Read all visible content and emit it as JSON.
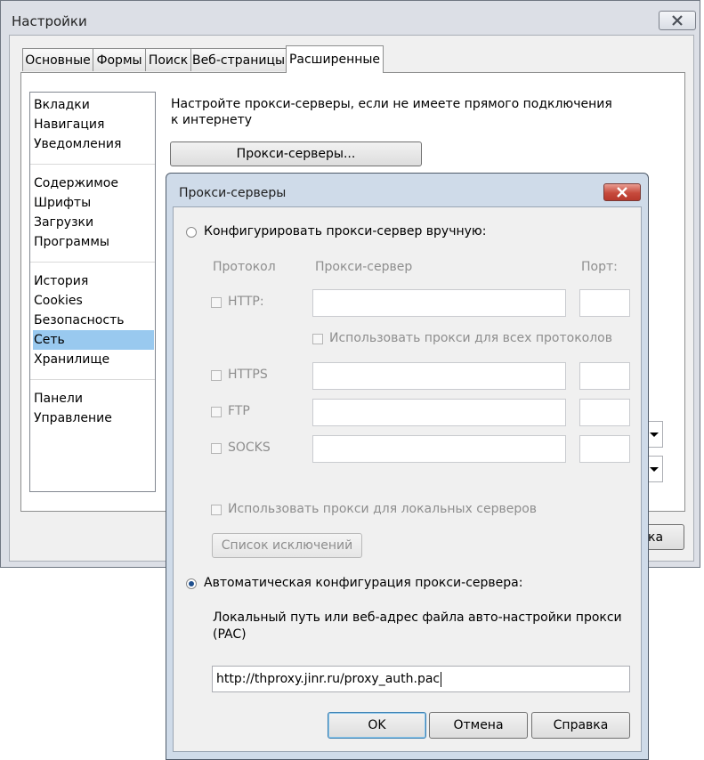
{
  "main_window": {
    "title": "Настройки",
    "tabs": [
      "Основные",
      "Формы",
      "Поиск",
      "Веб-страницы",
      "Расширенные"
    ],
    "active_tab_index": 4,
    "categories": [
      [
        "Вкладки",
        "Навигация",
        "Уведомления"
      ],
      [
        "Содержимое",
        "Шрифты",
        "Загрузки",
        "Программы"
      ],
      [
        "История",
        "Cookies",
        "Безопасность",
        "Сеть",
        "Хранилище"
      ],
      [
        "Панели",
        "Управление"
      ]
    ],
    "selected_category": "Сеть",
    "network_description": "Настройте прокси-серверы, если не имеете прямого подключения к интернету",
    "proxy_button_label": "Прокси-серверы...",
    "partial_button_label": "ка"
  },
  "proxy_dialog": {
    "title": "Прокси-серверы",
    "manual_radio_label": "Конфигурировать прокси-сервер вручную:",
    "manual_selected": false,
    "columns": {
      "protocol": "Протокол",
      "server": "Прокси-сервер",
      "port": "Порт:"
    },
    "protocols": [
      {
        "label": "HTTP:",
        "server": "",
        "port": ""
      },
      {
        "label": "HTTPS",
        "server": "",
        "port": ""
      },
      {
        "label": "FTP",
        "server": "",
        "port": ""
      },
      {
        "label": "SOCKS",
        "server": "",
        "port": ""
      }
    ],
    "use_for_all_label": "Использовать прокси для всех протоколов",
    "use_for_local_label": "Использовать прокси для локальных серверов",
    "exceptions_button_label": "Список исключений",
    "auto_radio_label": "Автоматическая конфигурация прокси-сервера:",
    "auto_selected": true,
    "pac_description": "Локальный путь или веб-адрес файла авто-настройки прокси (PAC)",
    "pac_url": "http://thproxy.jinr.ru/proxy_auth.pac",
    "ok_label": "OK",
    "cancel_label": "Отмена",
    "help_label": "Справка"
  }
}
